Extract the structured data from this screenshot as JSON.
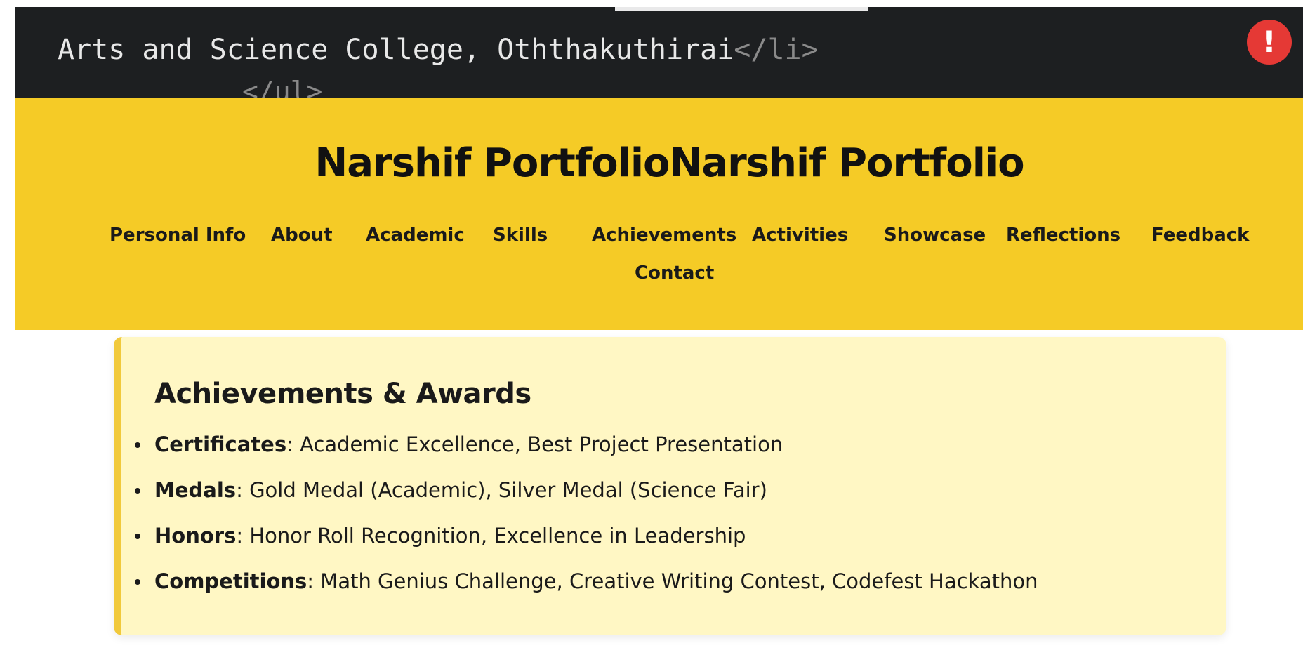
{
  "code": {
    "line1_text": "Arts and Science College, Oththakuthirai",
    "line1_tag": "</li>",
    "line2_tag": "</ul>",
    "error_symbol": "!"
  },
  "header": {
    "title": "Narshif PortfolioNarshif Portfolio",
    "nav": [
      {
        "label": "Personal Info"
      },
      {
        "label": "About"
      },
      {
        "label": "Academic"
      },
      {
        "label": "Skills"
      },
      {
        "label": "Achievements"
      },
      {
        "label": "Activities"
      },
      {
        "label": "Showcase"
      },
      {
        "label": "Reflections"
      },
      {
        "label": "Feedback"
      },
      {
        "label": "Contact"
      }
    ]
  },
  "achievements": {
    "title": "Achievements & Awards",
    "items": [
      {
        "label": "Certificates",
        "value": "Academic Excellence, Best Project Presentation"
      },
      {
        "label": "Medals",
        "value": "Gold Medal (Academic), Silver Medal (Science Fair)"
      },
      {
        "label": "Honors",
        "value": "Honor Roll Recognition, Excellence in Leadership"
      },
      {
        "label": "Competitions",
        "value": "Math Genius Challenge, Creative Writing Contest, Codefest Hackathon"
      }
    ]
  },
  "colors": {
    "code_bg": "#1d1f21",
    "header_bg": "#f5cb26",
    "card_bg": "#fff7c4",
    "card_accent": "#f1c93b",
    "error_red": "#e53935"
  }
}
